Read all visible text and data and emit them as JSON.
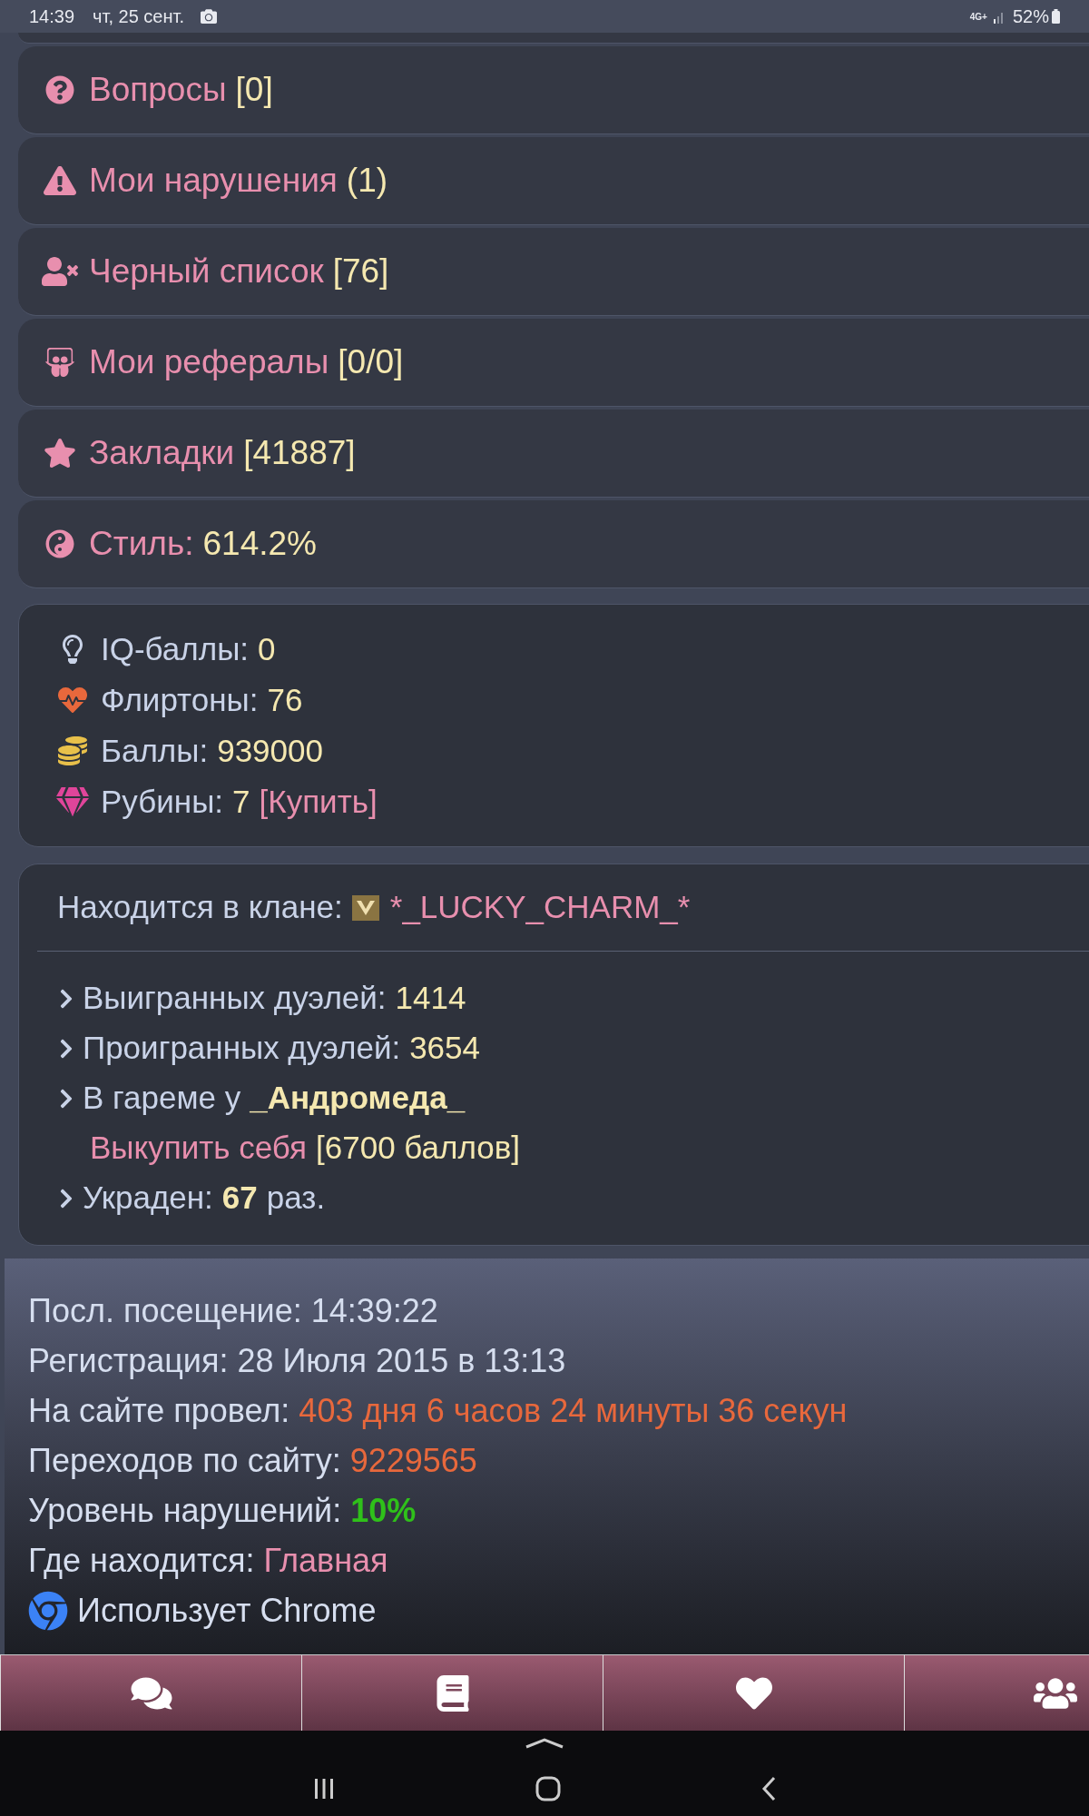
{
  "status_bar": {
    "time": "14:39",
    "date": "чт, 25 сент.",
    "network": "4G+",
    "battery": "52%"
  },
  "menu": [
    {
      "label": "Вопросы",
      "count": "[0]"
    },
    {
      "label": "Мои нарушения",
      "count": "(1)"
    },
    {
      "label": "Черный список",
      "count": "[76]"
    },
    {
      "label": "Мои рефералы",
      "count": "[0/0]"
    },
    {
      "label": "Закладки",
      "count": "[41887]"
    },
    {
      "label": "Стиль:",
      "count": "614.2%"
    }
  ],
  "stats": [
    {
      "label": "IQ-баллы:",
      "value": "0"
    },
    {
      "label": "Флиртоны:",
      "value": "76"
    },
    {
      "label": "Баллы:",
      "value": "939000"
    },
    {
      "label": "Рубины:",
      "value": "7",
      "link": "[Купить]"
    }
  ],
  "clan": {
    "label": "Находится в клане:",
    "name": "*_LUCKY_CHARM_*",
    "items": [
      {
        "kind": "stat",
        "label": "Выигранных дуэлей:",
        "value": "1414"
      },
      {
        "kind": "stat",
        "label": "Проигранных дуэлей:",
        "value": "3654"
      },
      {
        "kind": "harem",
        "label": "В гареме у",
        "value": "_Андромеда_",
        "link": "Выкупить себя",
        "price": "[6700 баллов]"
      },
      {
        "kind": "stolen",
        "label": "Украден:",
        "value": "67",
        "suffix": "раз."
      }
    ]
  },
  "info": [
    {
      "label": "Посл. посещение:",
      "value": "14:39:22",
      "color": "#d6deef"
    },
    {
      "label": "Регистрация:",
      "value": "28 Июля 2015 в 13:13",
      "color": "#d6deef"
    },
    {
      "label": "На сайте провел:",
      "value": "403 дня 6 часов 24 минуты 36 секун",
      "color": "#e8683c"
    },
    {
      "label": "Переходов по сайту:",
      "value": "9229565",
      "color": "#e8683c"
    },
    {
      "label": "Уровень нарушений:",
      "value": "10%",
      "color": "#2fc01a"
    },
    {
      "label": "Где находится:",
      "value": "Главная",
      "color": "#e88fae"
    }
  ],
  "browser": "Использует Chrome"
}
